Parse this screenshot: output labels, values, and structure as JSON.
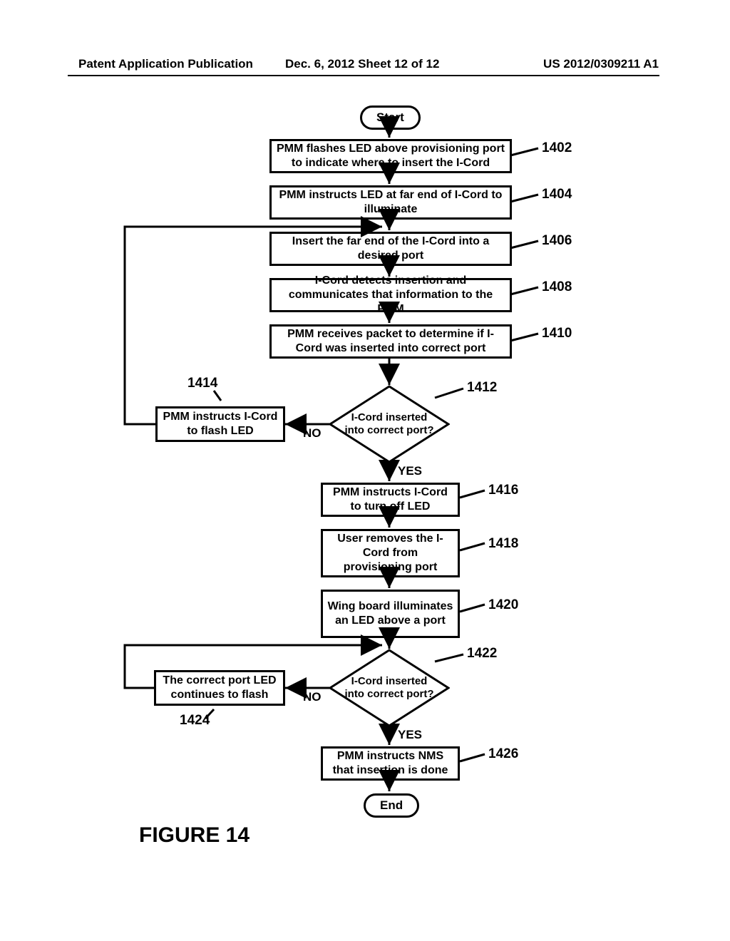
{
  "header": {
    "left": "Patent Application Publication",
    "center": "Dec. 6, 2012   Sheet 12 of 12",
    "right": "US 2012/0309211 A1"
  },
  "figure_title": "FIGURE 14",
  "nodes": {
    "start": "Start",
    "end": "End",
    "b1402": "PMM flashes LED above provisioning port to indicate where to insert the I-Cord",
    "b1404": "PMM instructs LED at far end of I-Cord to illuminate",
    "b1406": "Insert the far end of the I-Cord into a desired port",
    "b1408": "I-Cord detects insertion and communicates that information to the PMM",
    "b1410": "PMM receives packet to determine if I-Cord was inserted into correct port",
    "d1412": "I-Cord inserted into correct port?",
    "b1414": "PMM instructs I-Cord to flash LED",
    "b1416": "PMM instructs I-Cord to turn off LED",
    "b1418": "User removes the I-Cord from provisioning port",
    "b1420": "Wing board illuminates an LED above a port",
    "d1422": "I-Cord inserted into correct port?",
    "b1424": "The correct port LED continues to flash",
    "b1426": "PMM instructs NMS that insertion is done"
  },
  "labels": {
    "n1402": "1402",
    "n1404": "1404",
    "n1406": "1406",
    "n1408": "1408",
    "n1410": "1410",
    "n1412": "1412",
    "n1414": "1414",
    "n1416": "1416",
    "n1418": "1418",
    "n1420": "1420",
    "n1422": "1422",
    "n1424": "1424",
    "n1426": "1426",
    "no": "NO",
    "yes": "YES"
  }
}
